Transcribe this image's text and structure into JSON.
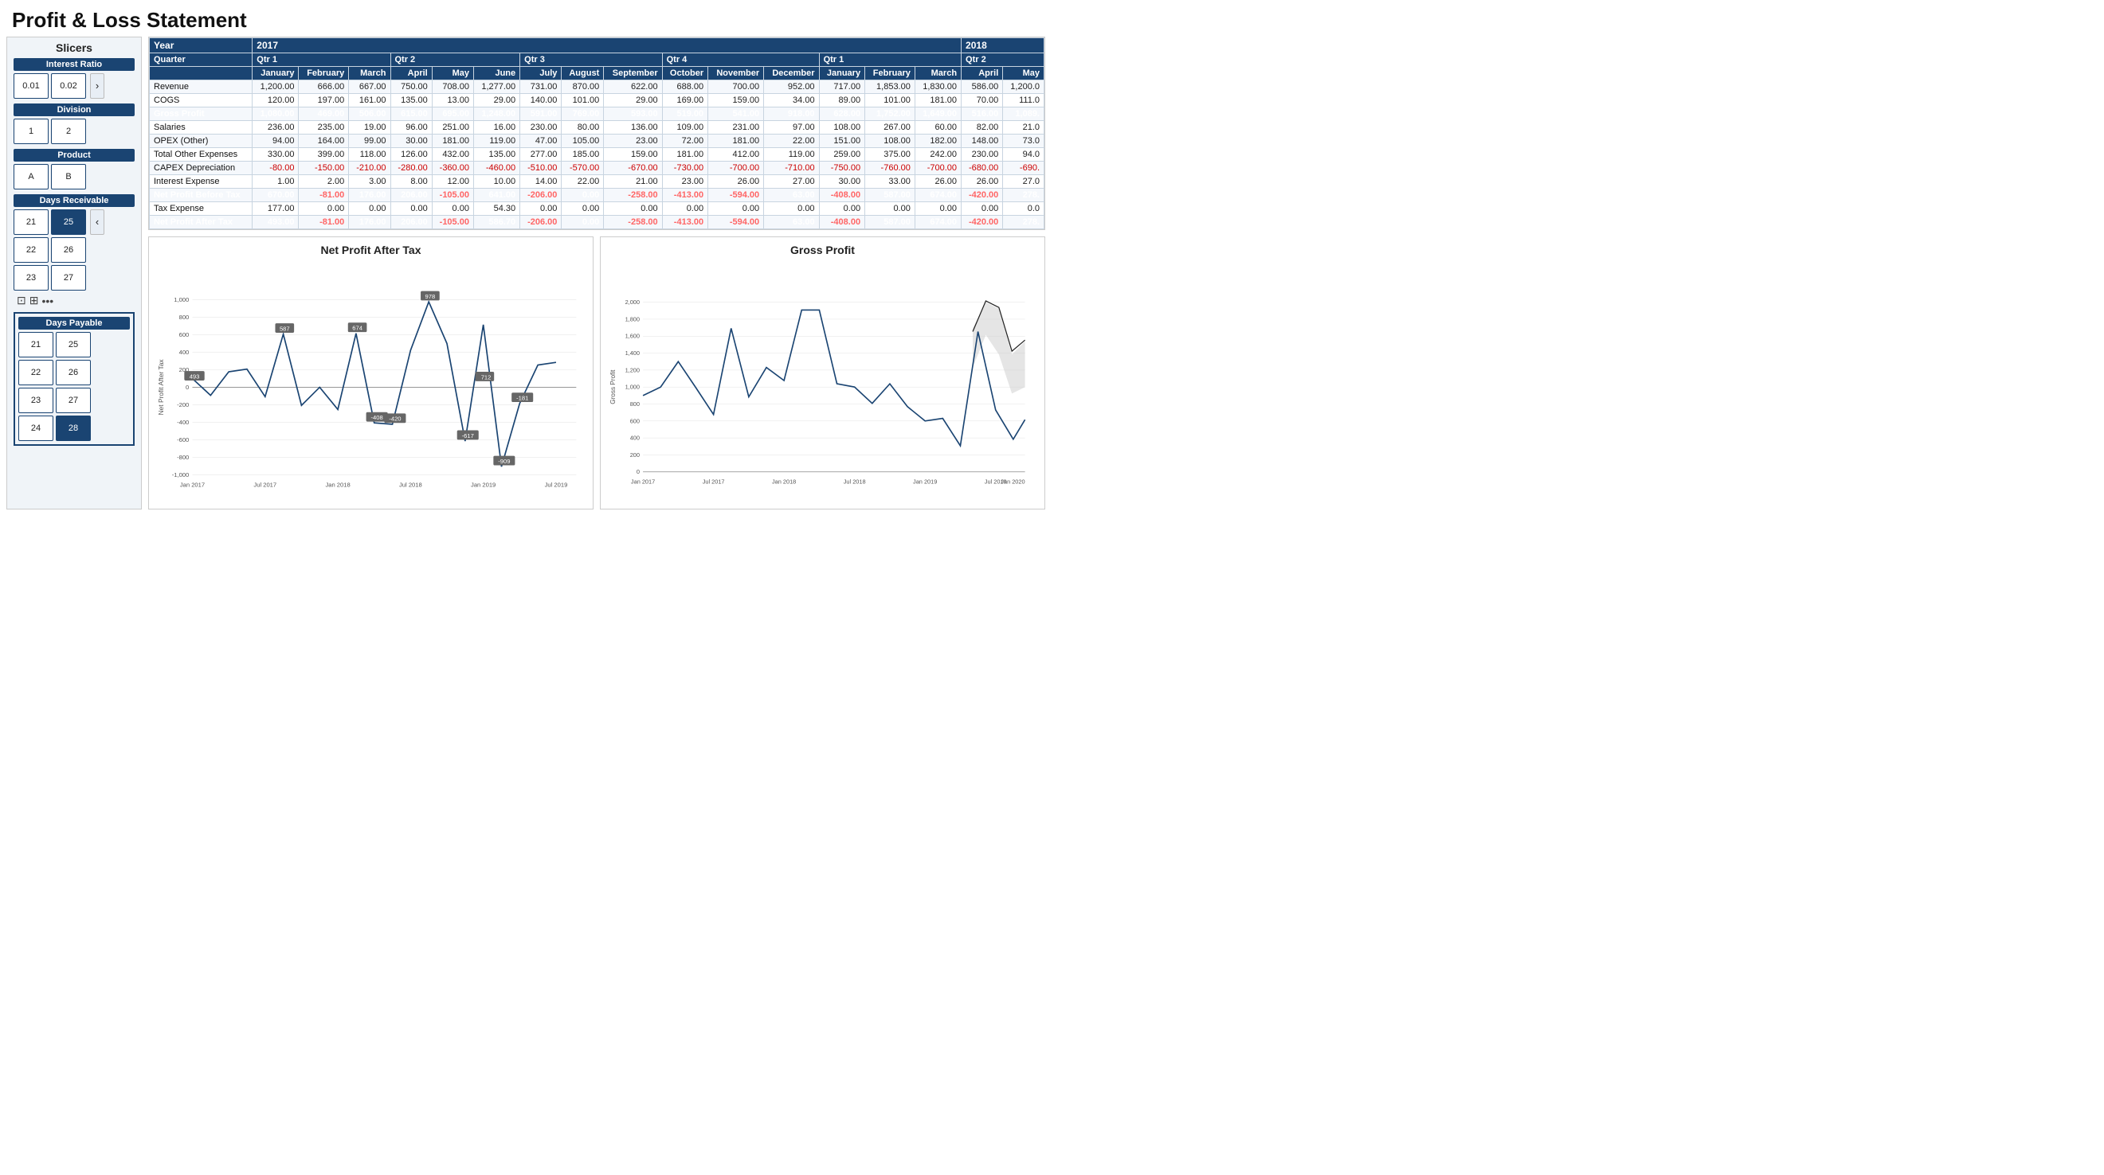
{
  "page": {
    "title": "Profit & Loss Statement"
  },
  "slicers": {
    "title": "Slicers",
    "groups": [
      {
        "label": "Interest Ratio",
        "buttons": [
          "0.01",
          "0.02"
        ],
        "selected": [],
        "has_nav": true
      },
      {
        "label": "Division",
        "buttons": [
          "1",
          "2"
        ],
        "selected": [],
        "has_nav": false
      },
      {
        "label": "Product",
        "buttons": [
          "A",
          "B"
        ],
        "selected": [],
        "has_nav": false
      },
      {
        "label": "Days Receivable",
        "buttons": [
          "21",
          "25",
          "22",
          "26",
          "23",
          "27"
        ],
        "selected": [
          "25"
        ],
        "has_nav": true
      }
    ],
    "days_payable": {
      "label": "Days Payable",
      "buttons": [
        "21",
        "25",
        "22",
        "26",
        "23",
        "27",
        "24",
        "28"
      ],
      "selected": [
        "28"
      ]
    }
  },
  "table": {
    "year_headers": [
      {
        "label": "Year",
        "span": 1
      },
      {
        "label": "2017",
        "span": 15
      },
      {
        "label": "2018",
        "span": 5
      }
    ],
    "quarter_headers": [
      {
        "label": "Quarter",
        "span": 1
      },
      {
        "label": "Qtr 1",
        "span": 3
      },
      {
        "label": "Qtr 2",
        "span": 3
      },
      {
        "label": "Qtr 3",
        "span": 3
      },
      {
        "label": "Qtr 4",
        "span": 3
      },
      {
        "label": "Qtr 1",
        "span": 3
      },
      {
        "label": "Qtr 2",
        "span": 2
      }
    ],
    "months": [
      "",
      "January",
      "February",
      "March",
      "April",
      "May",
      "June",
      "July",
      "August",
      "September",
      "October",
      "November",
      "December",
      "January",
      "February",
      "March",
      "April",
      "May"
    ],
    "rows": [
      {
        "label": "Revenue",
        "bold": false,
        "values": [
          "1,200.00",
          "666.00",
          "667.00",
          "750.00",
          "708.00",
          "1,277.00",
          "731.00",
          "870.00",
          "622.00",
          "688.00",
          "700.00",
          "952.00",
          "717.00",
          "1,853.00",
          "1,830.00",
          "586.00",
          "1,200.0"
        ],
        "neg": []
      },
      {
        "label": "COGS",
        "bold": false,
        "values": [
          "120.00",
          "197.00",
          "161.00",
          "135.00",
          "13.00",
          "29.00",
          "140.00",
          "101.00",
          "29.00",
          "169.00",
          "159.00",
          "34.00",
          "89.00",
          "101.00",
          "181.00",
          "70.00",
          "111.0"
        ],
        "neg": []
      },
      {
        "label": "Gross Profit",
        "bold": true,
        "values": [
          "1,080.00",
          "469.00",
          "506.00",
          "615.00",
          "695.00",
          "1,248.00",
          "591.00",
          "769.00",
          "593.00",
          "519.00",
          "541.00",
          "918.00",
          "628.00",
          "1,752.00",
          "1,649.00",
          "516.00",
          "1,089."
        ],
        "neg": []
      },
      {
        "label": "Salaries",
        "bold": false,
        "values": [
          "236.00",
          "235.00",
          "19.00",
          "96.00",
          "251.00",
          "16.00",
          "230.00",
          "80.00",
          "136.00",
          "109.00",
          "231.00",
          "97.00",
          "108.00",
          "267.00",
          "60.00",
          "82.00",
          "21.0"
        ],
        "neg": []
      },
      {
        "label": "OPEX (Other)",
        "bold": false,
        "values": [
          "94.00",
          "164.00",
          "99.00",
          "30.00",
          "181.00",
          "119.00",
          "47.00",
          "105.00",
          "23.00",
          "72.00",
          "181.00",
          "22.00",
          "151.00",
          "108.00",
          "182.00",
          "148.00",
          "73.0"
        ],
        "neg": []
      },
      {
        "label": "Total Other Expenses",
        "bold": false,
        "values": [
          "330.00",
          "399.00",
          "118.00",
          "126.00",
          "432.00",
          "135.00",
          "277.00",
          "185.00",
          "159.00",
          "181.00",
          "412.00",
          "119.00",
          "259.00",
          "375.00",
          "242.00",
          "230.00",
          "94.0"
        ],
        "neg": []
      },
      {
        "label": "CAPEX Depreciation",
        "bold": false,
        "values": [
          "-80.00",
          "-150.00",
          "-210.00",
          "-280.00",
          "-360.00",
          "-460.00",
          "-510.00",
          "-570.00",
          "-670.00",
          "-730.00",
          "-700.00",
          "-710.00",
          "-750.00",
          "-760.00",
          "-700.00",
          "-680.00",
          "-690."
        ],
        "neg": [
          0,
          1,
          2,
          3,
          4,
          5,
          6,
          7,
          8,
          9,
          10,
          11,
          12,
          13,
          14,
          15,
          16
        ]
      },
      {
        "label": "Interest Expense",
        "bold": false,
        "values": [
          "1.00",
          "2.00",
          "3.00",
          "8.00",
          "12.00",
          "10.00",
          "14.00",
          "22.00",
          "21.00",
          "23.00",
          "26.00",
          "27.00",
          "30.00",
          "33.00",
          "26.00",
          "26.00",
          "27.0"
        ],
        "neg": []
      },
      {
        "label": "Net Profit Before Tax",
        "bold": true,
        "values": [
          "670.00",
          "-81.00",
          "176.00",
          "206.00",
          "-105.00",
          "641.00",
          "-206.00",
          "0.00",
          "-258.00",
          "-413.00",
          "-594.00",
          "63.00",
          "-408.00",
          "587.00",
          "674.00",
          "-420.00",
          "278."
        ],
        "neg": [
          1,
          4,
          6,
          8,
          9,
          10,
          12,
          15
        ]
      },
      {
        "label": "Tax Expense",
        "bold": false,
        "values": [
          "177.00",
          "0.00",
          "0.00",
          "0.00",
          "0.00",
          "54.30",
          "0.00",
          "0.00",
          "0.00",
          "0.00",
          "0.00",
          "0.00",
          "0.00",
          "0.00",
          "0.00",
          "0.00",
          "0.0"
        ],
        "neg": []
      },
      {
        "label": "Net Profit After Tax",
        "bold": true,
        "values": [
          "493.00",
          "-81.00",
          "176.00",
          "206.00",
          "-105.00",
          "586.70",
          "-206.00",
          "0.00",
          "-258.00",
          "-413.00",
          "-594.00",
          "63.00",
          "-408.00",
          "587.00",
          "674.00",
          "-420.00",
          "278."
        ],
        "neg": [
          1,
          4,
          6,
          8,
          9,
          10,
          12,
          15
        ]
      }
    ]
  },
  "charts": {
    "net_profit": {
      "title": "Net Profit After Tax",
      "y_axis_label": "Net Profit After Tax",
      "y_min": -1000,
      "y_max": 1000,
      "y_ticks": [
        "-1,000",
        "-800",
        "-600",
        "-400",
        "-200",
        "0",
        "200",
        "400",
        "600",
        "800",
        "1,000"
      ],
      "x_labels": [
        "Jan 2017",
        "Jul 2017",
        "Jan 2018",
        "Jul 2018",
        "Jan 2019",
        "Jul 2019"
      ],
      "data_points": [
        {
          "x": 0,
          "y": 493,
          "label": "493"
        },
        {
          "x": 1,
          "y": 200
        },
        {
          "x": 2,
          "y": 176
        },
        {
          "x": 3,
          "y": 206
        },
        {
          "x": 4,
          "y": -105
        },
        {
          "x": 5,
          "y": 587,
          "label": "587"
        },
        {
          "x": 6,
          "y": -81
        },
        {
          "x": 7,
          "y": -206
        },
        {
          "x": 8,
          "y": 0
        },
        {
          "x": 9,
          "y": 674,
          "label": "674"
        },
        {
          "x": 10,
          "y": -408,
          "label": "-408"
        },
        {
          "x": 11,
          "y": -420,
          "label": "-420"
        },
        {
          "x": 12,
          "y": 420
        },
        {
          "x": 13,
          "y": 978,
          "label": "978"
        },
        {
          "x": 14,
          "y": 500
        },
        {
          "x": 15,
          "y": -617,
          "label": "-617"
        },
        {
          "x": 16,
          "y": 712,
          "label": "712"
        },
        {
          "x": 17,
          "y": -909,
          "label": "-909"
        },
        {
          "x": 18,
          "y": -181,
          "label": "-181"
        },
        {
          "x": 19,
          "y": 200
        },
        {
          "x": 20,
          "y": 280
        }
      ]
    },
    "gross_profit": {
      "title": "Gross Profit",
      "y_axis_label": "Gross Profit",
      "y_min": 0,
      "y_max": 2000,
      "y_ticks": [
        "0",
        "200",
        "400",
        "600",
        "800",
        "1,000",
        "1,200",
        "1,400",
        "1,600",
        "1,800",
        "2,000"
      ],
      "x_labels": [
        "Jan 2017",
        "Jul 2017",
        "Jan 2018",
        "Jul 2018",
        "Jan 2019",
        "Jul 2019",
        "Jan 2020"
      ]
    }
  }
}
